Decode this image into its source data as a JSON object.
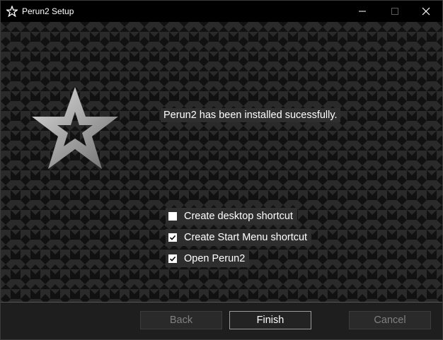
{
  "window": {
    "title": "Perun2 Setup",
    "icon": "star-icon",
    "controls": [
      "minimize-icon",
      "maximize-icon",
      "close-icon"
    ]
  },
  "main": {
    "logo": "star-logo-icon",
    "message": "Perun2 has been installed sucessfully.",
    "options": [
      {
        "label": "Create desktop shortcut",
        "checked": false
      },
      {
        "label": "Create Start Menu shortcut",
        "checked": true
      },
      {
        "label": "Open Perun2",
        "checked": true
      }
    ]
  },
  "footer": {
    "back_label": "Back",
    "finish_label": "Finish",
    "cancel_label": "Cancel"
  },
  "colors": {
    "background": "#000000",
    "pattern_dark": "#111111",
    "pattern_light": "#2a2a2a",
    "footer": "#1e1e1e",
    "disabled_text": "#808080"
  }
}
